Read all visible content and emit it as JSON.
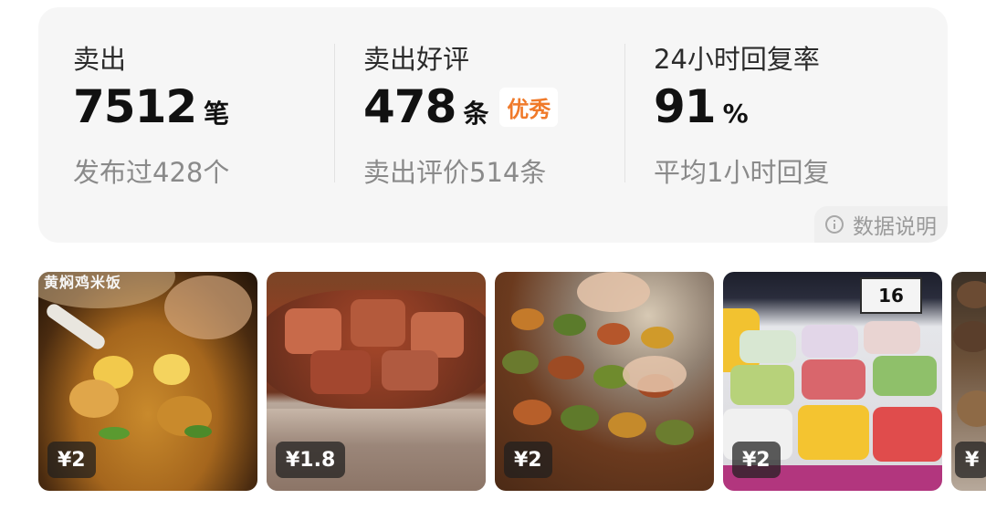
{
  "stats": [
    {
      "label": "卖出",
      "value": "7512",
      "unit": "笔",
      "badge": "",
      "sub": "发布过428个"
    },
    {
      "label": "卖出好评",
      "value": "478",
      "unit": "条",
      "badge": "优秀",
      "sub": "卖出评价514条"
    },
    {
      "label": "24小时回复率",
      "value": "91",
      "unit": "%",
      "badge": "",
      "sub": "平均1小时回复"
    }
  ],
  "data_note": "数据说明",
  "thumbnails": [
    {
      "price": "¥2",
      "overlay_text": "黄焖鸡米饭"
    },
    {
      "price": "¥1.8"
    },
    {
      "price": "¥2"
    },
    {
      "price": "¥2",
      "overlay_text": "16"
    },
    {
      "price": "¥"
    }
  ]
}
